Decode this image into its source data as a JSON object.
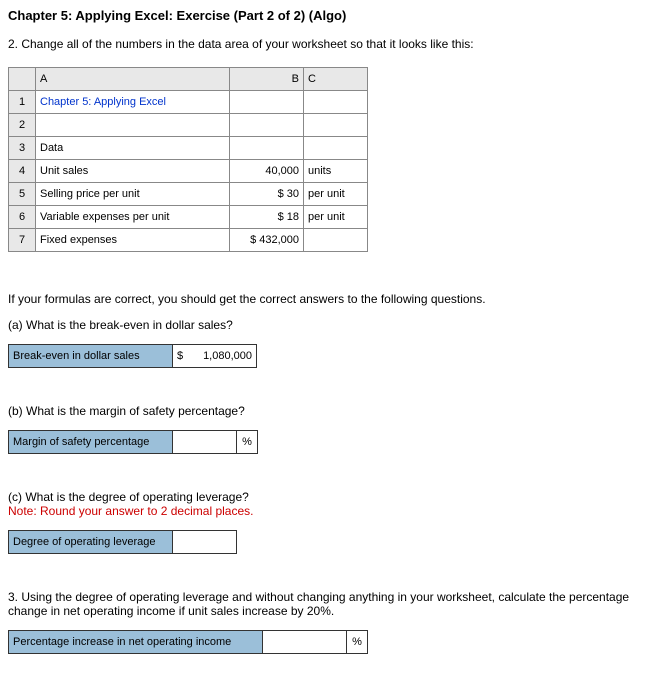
{
  "title": "Chapter 5: Applying Excel: Exercise (Part 2 of 2) (Algo)",
  "instruction": "2. Change all of the numbers in the data area of your worksheet so that it looks like this:",
  "excel": {
    "headers": {
      "a": "A",
      "b": "B",
      "c": "C"
    },
    "rows": [
      {
        "n": "1",
        "a": "Chapter 5: Applying Excel",
        "b": "",
        "c": "",
        "blue": true
      },
      {
        "n": "2",
        "a": "",
        "b": "",
        "c": ""
      },
      {
        "n": "3",
        "a": "Data",
        "b": "",
        "c": ""
      },
      {
        "n": "4",
        "a": "Unit sales",
        "b": "40,000",
        "c": "units"
      },
      {
        "n": "5",
        "a": "Selling price per unit",
        "b": "$         30",
        "c": "per unit"
      },
      {
        "n": "6",
        "a": "Variable expenses per unit",
        "b": "$         18",
        "c": "per unit"
      },
      {
        "n": "7",
        "a": "Fixed expenses",
        "b": "$  432,000",
        "c": ""
      }
    ]
  },
  "midtext": "If your formulas are correct, you should get the correct answers to the following questions.",
  "qa": {
    "a": {
      "q": "(a) What is the break-even in dollar sales?",
      "label": "Break-even in dollar sales",
      "prefix": "$",
      "value": "1,080,000"
    },
    "b": {
      "q": "(b) What is the margin of safety percentage?",
      "label": "Margin of safety percentage",
      "value": "",
      "suffix": "%"
    },
    "c": {
      "q": "(c) What is the degree of operating leverage?",
      "note": "Note: Round your answer to 2 decimal places.",
      "label": "Degree of operating leverage",
      "value": ""
    }
  },
  "q3": {
    "text": "3. Using the degree of operating leverage and without changing anything in your worksheet, calculate the percentage change in net operating income if unit sales increase by 20%.",
    "label": "Percentage increase in net operating income",
    "value": "",
    "suffix": "%"
  }
}
